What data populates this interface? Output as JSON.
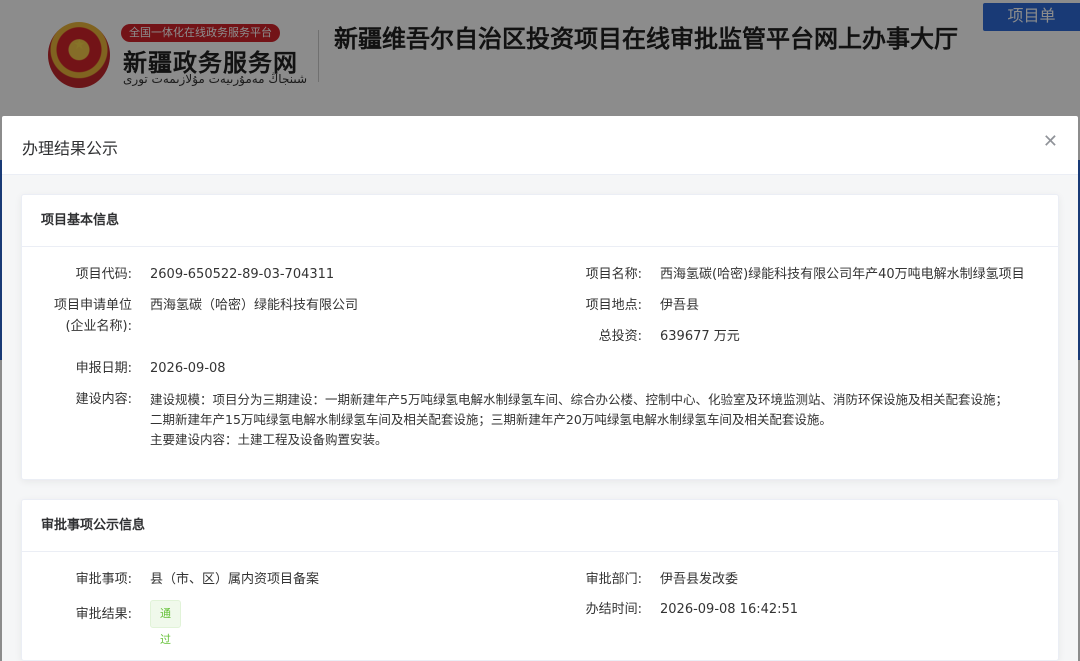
{
  "header": {
    "platform_badge": "全国一体化在线政务服务平台",
    "portal_name": "新疆政务服务网",
    "portal_name_uy": "شىنجاڭ مەمۇرىيەت مۇلازىمەت تورى",
    "page_title": "新疆维吾尔自治区投资项目在线审批监管平台网上办事大厅",
    "top_button": "项目单"
  },
  "dialog": {
    "title": "办理结果公示",
    "close_icon": "close-icon"
  },
  "basic_info": {
    "section_title": "项目基本信息",
    "code_label": "项目代码:",
    "code_value": "2609-650522-89-03-704311",
    "name_label": "项目名称:",
    "name_value": "西海氢碳(哈密)绿能科技有限公司年产40万吨电解水制绿氢项目",
    "applicant_label_1": "项目申请单位",
    "applicant_label_2": "(企业名称):",
    "applicant_value": "西海氢碳（哈密）绿能科技有限公司",
    "location_label": "项目地点:",
    "location_value": "伊吾县",
    "investment_label": "总投资:",
    "investment_value": "639677 万元",
    "date_label": "申报日期:",
    "date_value": "2026-09-08",
    "content_label": "建设内容:",
    "content_line_1": "建设规模：项目分为三期建设：一期新建年产5万吨绿氢电解水制绿氢车间、综合办公楼、控制中心、化验室及环境监测站、消防环保设施及相关配套设施；",
    "content_line_2": "二期新建年产15万吨绿氢电解水制绿氢车间及相关配套设施；三期新建年产20万吨绿氢电解水制绿氢车间及相关配套设施。",
    "content_line_3": "主要建设内容：土建工程及设备购置安装。"
  },
  "approval_info": {
    "section_title": "审批事项公示信息",
    "item_label": "审批事项:",
    "item_value": "县（市、区）属内资项目备案",
    "dept_label": "审批部门:",
    "dept_value": "伊吾县发改委",
    "result_label": "审批结果:",
    "result_value": "通过",
    "time_label": "办结时间:",
    "time_value": "2026-09-08 16:42:51"
  },
  "colors": {
    "accent": "#2e6bd8",
    "success": "#67c23a"
  }
}
